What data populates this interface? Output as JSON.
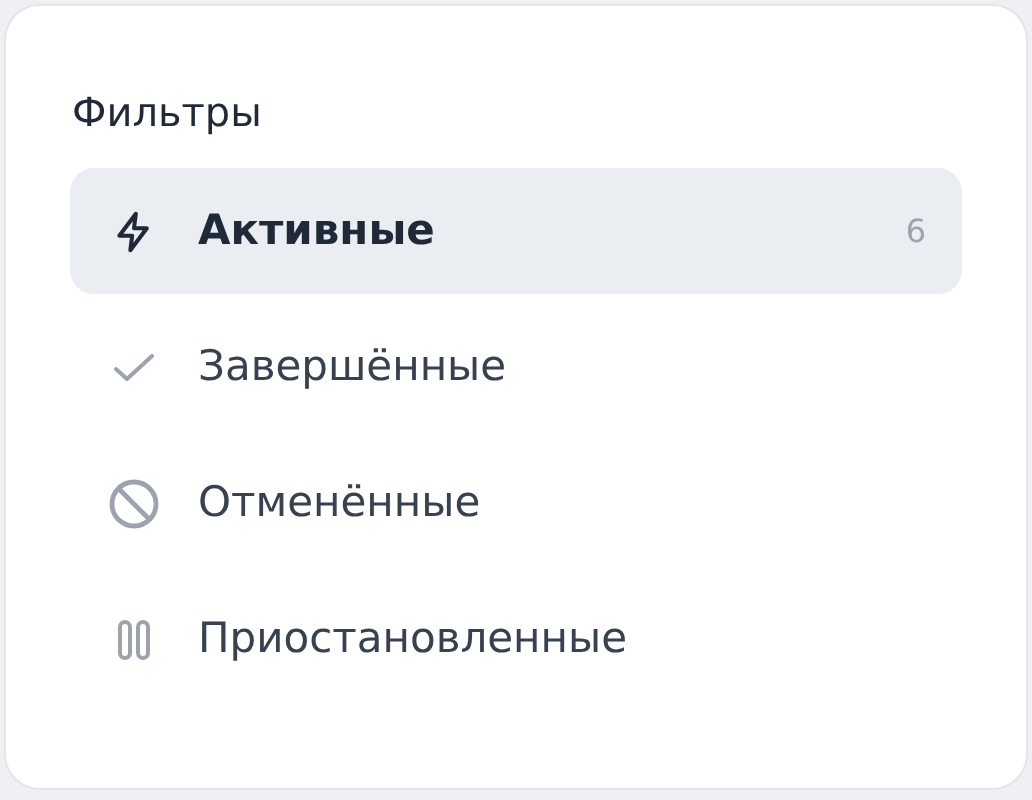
{
  "title": "Фильтры",
  "filters": [
    {
      "kind": "bolt",
      "label": "Активные",
      "count": "6",
      "selected": true
    },
    {
      "kind": "check",
      "label": "Завершённые",
      "selected": false
    },
    {
      "kind": "ban",
      "label": "Отменённые",
      "selected": false
    },
    {
      "kind": "pause",
      "label": "Приостановленные",
      "selected": false
    }
  ]
}
